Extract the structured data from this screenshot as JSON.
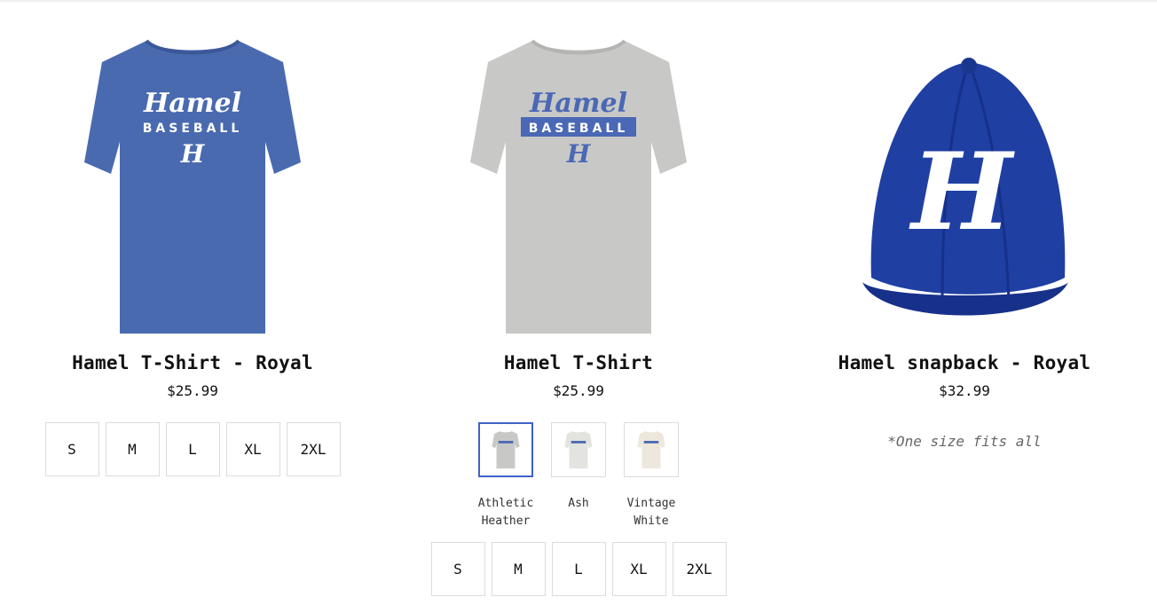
{
  "products": [
    {
      "title": "Hamel T-Shirt - Royal",
      "price": "$25.99",
      "image": {
        "kind": "tshirt",
        "shirt_color": "#4a6ab0",
        "print_color": "#ffffff",
        "word": "Hamel",
        "sub": "BASEBALL",
        "letter": "H"
      },
      "sizes": [
        "S",
        "M",
        "L",
        "XL",
        "2XL"
      ]
    },
    {
      "title": "Hamel T-Shirt",
      "price": "$25.99",
      "image": {
        "kind": "tshirt",
        "shirt_color": "#c8c8c6",
        "print_color": "#4a68b5",
        "word": "Hamel",
        "sub": "BASEBALL",
        "letter": "H"
      },
      "colors": [
        {
          "label": "Athletic Heather",
          "swatch": "#c8c8c6",
          "selected": true
        },
        {
          "label": "Ash",
          "swatch": "#e6e6e3",
          "selected": false
        },
        {
          "label": "Vintage White",
          "swatch": "#efeae0",
          "selected": false
        }
      ],
      "sizes": [
        "S",
        "M",
        "L",
        "XL",
        "2XL"
      ]
    },
    {
      "title": "Hamel snapback - Royal",
      "price": "$32.99",
      "image": {
        "kind": "cap",
        "cap_color": "#1f3fa3",
        "letter": "H"
      },
      "note": "*One size fits all"
    }
  ],
  "colors": {
    "selected_border": "#3f62c9",
    "border": "#dcdcdc"
  }
}
